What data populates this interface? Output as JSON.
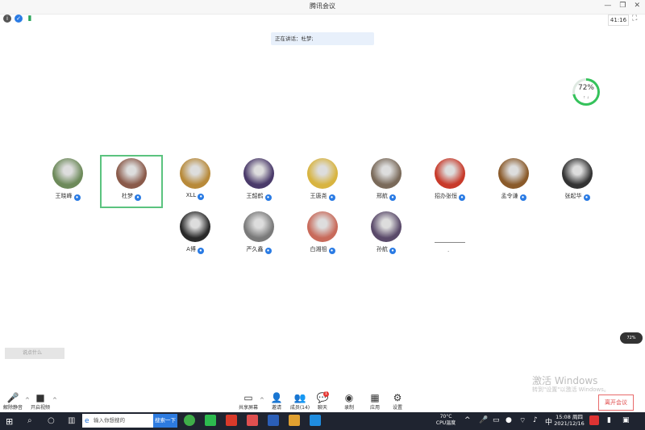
{
  "window": {
    "title": "腾讯会议",
    "timer": "41:16"
  },
  "speaking": "正在讲话：杜梦;",
  "cpu": {
    "value": "72%",
    "fraction": 0.72,
    "side_value": "72%"
  },
  "participants": [
    {
      "name": "王晓峰",
      "color": "#6d8a5a",
      "active": false
    },
    {
      "name": "杜梦",
      "color": "#8a5a4a",
      "active": true
    },
    {
      "name": "XLL",
      "color": "#b88a3a",
      "active": false
    },
    {
      "name": "王韶鹤",
      "color": "#4a3a6a",
      "active": false
    },
    {
      "name": "王唐尧",
      "color": "#d8b440",
      "active": false
    },
    {
      "name": "邢航",
      "color": "#7a6a5a",
      "active": false
    },
    {
      "name": "招办张恒",
      "color": "#c83a2a",
      "active": false
    },
    {
      "name": "孟令谦",
      "color": "#8a5a2a",
      "active": false
    },
    {
      "name": "张起华",
      "color": "#333333",
      "active": false
    },
    {
      "name": "A博",
      "color": "#2a2a2a",
      "active": false
    },
    {
      "name": "严久鑫",
      "color": "#7a7a7a",
      "active": false
    },
    {
      "name": "白湘祖",
      "color": "#c86a5a",
      "active": false
    },
    {
      "name": "孙航",
      "color": "#5a4a6a",
      "active": false
    },
    {
      "name": "",
      "color": "",
      "active": false
    }
  ],
  "blank_participant": ".",
  "chat": {
    "placeholder": "说点什么"
  },
  "watermark": {
    "line1": "激活 Windows",
    "line2": "转到\"设置\"以激活 Windows。"
  },
  "toolbar": {
    "unmute": "解除静音",
    "video": "开启视频",
    "share": "共享屏幕",
    "invite": "邀请",
    "members": "成员(14)",
    "chat": "聊天",
    "chat_badge": "1",
    "record": "录制",
    "apps": "应用",
    "settings": "设置",
    "leave": "离开会议"
  },
  "taskbar": {
    "search_placeholder": "输入你想搜的",
    "search_button": "搜索一下",
    "temp": "70°C",
    "temp_label": "CPU温度",
    "ime": "中",
    "time": "15:08 周四",
    "date": "2021/12/16"
  }
}
